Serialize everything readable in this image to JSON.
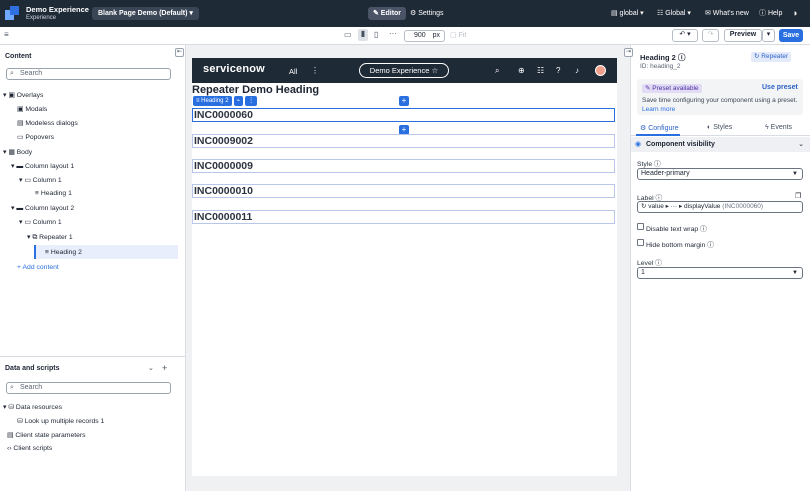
{
  "app": {
    "title": "Demo Experience",
    "subtitle": "Experience",
    "page_selector": "Blank Page Demo (Default) ▾",
    "tab_editor": "✎ Editor",
    "tab_settings": "⚙ Settings",
    "scope": "▤ global ▾",
    "language": "☷ Global ▾",
    "whats_new": "✉ What's new",
    "help": "ⓘ Help",
    "theme_icon": "◑"
  },
  "toolbar": {
    "width_value": "900",
    "width_unit": "px",
    "fit_label": "Fit",
    "preview_label": "Preview",
    "save_label": "Save"
  },
  "content_panel": {
    "title": "Content",
    "search_placeholder": "Search",
    "tree": [
      {
        "label": "Overlays",
        "level": 0
      },
      {
        "label": "Modals",
        "level": 1
      },
      {
        "label": "Modeless dialogs",
        "level": 1
      },
      {
        "label": "Popovers",
        "level": 1
      },
      {
        "label": "Body",
        "level": 0
      },
      {
        "label": "Column layout 1",
        "level": 1
      },
      {
        "label": "Column 1",
        "level": 2
      },
      {
        "label": "Heading 1",
        "level": 3
      },
      {
        "label": "Column layout 2",
        "level": 1
      },
      {
        "label": "Column 1",
        "level": 2
      },
      {
        "label": "Repeater 1",
        "level": 3
      },
      {
        "label": "Heading 2",
        "level": 4
      }
    ],
    "add_content": "Add content"
  },
  "data_panel": {
    "title": "Data and scripts",
    "search_placeholder": "Search",
    "items": [
      {
        "label": "Data resources"
      },
      {
        "label": "Look up multiple records 1"
      },
      {
        "label": "Client state parameters"
      },
      {
        "label": "Client scripts"
      }
    ]
  },
  "canvas": {
    "brand": "servicenow",
    "nav_all": "All",
    "experience_pill": "Demo Experience ☆",
    "page_heading": "Repeater Demo Heading",
    "selected_component_tag": "Heading 2",
    "records": [
      "INC0000060",
      "INC0009002",
      "INC0000009",
      "INC0000010",
      "INC0000011"
    ]
  },
  "config_panel": {
    "component_title": "Heading 2",
    "component_id": "ID: heading_2",
    "parent_badge": "Repeater",
    "preset_tag": "Preset available",
    "use_preset": "Use preset",
    "preset_desc": "Save time configuring your component using a preset.",
    "learn_more": "Learn more",
    "tabs": [
      "Configure",
      "Styles",
      "Events"
    ],
    "visibility_section": "Component visibility",
    "style_label": "Style",
    "style_value": "Header-primary",
    "label_label": "Label",
    "label_value": "value ▸ ··· ▸ displayValue",
    "label_preview": "(INC0000060)",
    "disable_wrap": "Disable text wrap",
    "hide_margin": "Hide bottom margin",
    "level_label": "Level",
    "level_value": "1"
  },
  "colors": {
    "accent": "#2a6fe0",
    "header": "#1f2a37"
  }
}
